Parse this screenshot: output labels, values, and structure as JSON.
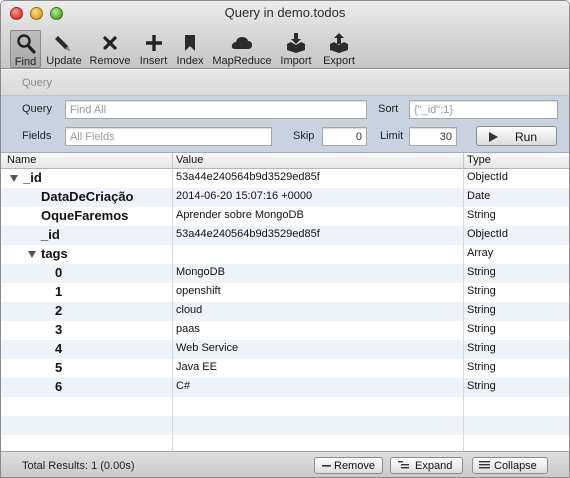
{
  "window": {
    "title": "Query in demo.todos"
  },
  "toolbar": {
    "items": [
      {
        "label": "Find",
        "icon": "magnifier-icon",
        "active": true
      },
      {
        "label": "Update",
        "icon": "pencil-icon"
      },
      {
        "label": "Remove",
        "icon": "x-icon"
      },
      {
        "label": "Insert",
        "icon": "plus-icon"
      },
      {
        "label": "Index",
        "icon": "bookmark-icon"
      },
      {
        "label": "MapReduce",
        "icon": "cloud-icon"
      },
      {
        "label": "Import",
        "icon": "import-icon"
      },
      {
        "label": "Export",
        "icon": "export-icon"
      }
    ]
  },
  "query": {
    "section_label": "Query",
    "query_label": "Query",
    "query_placeholder": "Find All",
    "sort_label": "Sort",
    "sort_placeholder": "{\"_id\":1}",
    "fields_label": "Fields",
    "fields_placeholder": "All Fields",
    "skip_label": "Skip",
    "skip_value": "0",
    "limit_label": "Limit",
    "limit_value": "30",
    "run_label": "Run"
  },
  "table": {
    "columns": {
      "name": "Name",
      "value": "Value",
      "type": "Type"
    },
    "rows": [
      {
        "name": "_id",
        "value": "53a44e240564b9d3529ed85f",
        "type": "ObjectId",
        "level": 0,
        "expander": true
      },
      {
        "name": "DataDeCriação",
        "value": "2014-06-20 15:07:16 +0000",
        "type": "Date",
        "level": 1,
        "expander": false
      },
      {
        "name": "OqueFaremos",
        "value": "Aprender sobre MongoDB",
        "type": "String",
        "level": 1,
        "expander": false
      },
      {
        "name": "_id",
        "value": "53a44e240564b9d3529ed85f",
        "type": "ObjectId",
        "level": 1,
        "expander": false
      },
      {
        "name": "tags",
        "value": "",
        "type": "Array",
        "level": 1,
        "expander": true
      },
      {
        "name": "0",
        "value": "MongoDB",
        "type": "String",
        "level": 2,
        "expander": false
      },
      {
        "name": "1",
        "value": "openshift",
        "type": "String",
        "level": 2,
        "expander": false
      },
      {
        "name": "2",
        "value": "cloud",
        "type": "String",
        "level": 2,
        "expander": false
      },
      {
        "name": "3",
        "value": "paas",
        "type": "String",
        "level": 2,
        "expander": false
      },
      {
        "name": "4",
        "value": "Web Service",
        "type": "String",
        "level": 2,
        "expander": false
      },
      {
        "name": "5",
        "value": "Java EE",
        "type": "String",
        "level": 2,
        "expander": false
      },
      {
        "name": "6",
        "value": "C#",
        "type": "String",
        "level": 2,
        "expander": false
      }
    ]
  },
  "footer": {
    "total": "Total Results: 1 (0.00s)",
    "remove_label": "Remove",
    "expand_label": "Expand",
    "collapse_label": "Collapse"
  }
}
